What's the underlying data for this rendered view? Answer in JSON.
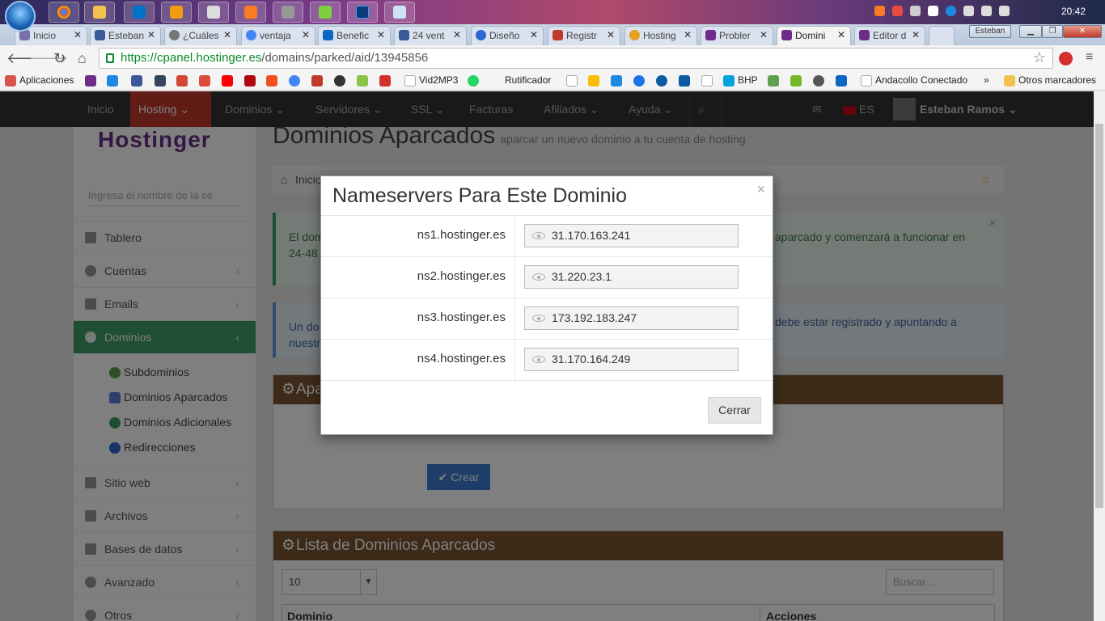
{
  "os": {
    "taskbar_apps": [
      "chrome-icon",
      "file-explorer-icon",
      "outlook-icon",
      "media-player-icon",
      "app-icon",
      "xampp-icon",
      "notepad-icon",
      "evernote-icon",
      "photoshop-icon",
      "files-icon"
    ],
    "clock": "20:42"
  },
  "browser": {
    "tabs": [
      {
        "label": "Inicio",
        "color": "#7a6fae"
      },
      {
        "label": "Esteban",
        "color": "#3b5998"
      },
      {
        "label": "¿Cuáles",
        "color": "#555555"
      },
      {
        "label": "ventaja",
        "color": "#4285f4"
      },
      {
        "label": "Benefic",
        "color": "#0a66c2"
      },
      {
        "label": "24 vent",
        "color": "#3a5a9a"
      },
      {
        "label": "Diseño",
        "color": "#2a6ad0"
      },
      {
        "label": "Registr",
        "color": "#c0392b"
      },
      {
        "label": "Hosting",
        "color": "#e5a020"
      },
      {
        "label": "Probler",
        "color": "#6d2c8a"
      },
      {
        "label": "Domini",
        "color": "#6d2c8a"
      },
      {
        "label": "Editor d",
        "color": "#6d2c8a"
      }
    ],
    "profile_name": "Esteban",
    "url_host": "https://cpanel.hostinger.es",
    "url_path": "/domains/parked/aid/13945856",
    "bookmarks": [
      {
        "label": "Aplicaciones",
        "color": "#d9534f"
      },
      {
        "label": "",
        "color": "#6d2c8a"
      },
      {
        "label": "",
        "color": "#1e88e5"
      },
      {
        "label": "",
        "color": "#3b5998"
      },
      {
        "label": "",
        "color": "#35465c"
      },
      {
        "label": "",
        "color": "#d14836"
      },
      {
        "label": "",
        "color": "#dd4b39"
      },
      {
        "label": "",
        "color": "#ff0000"
      },
      {
        "label": "",
        "color": "#b20710"
      },
      {
        "label": "",
        "color": "#f25022"
      },
      {
        "label": "",
        "color": "#4285f4"
      },
      {
        "label": "",
        "color": "#c0392b"
      },
      {
        "label": "",
        "color": "#333333"
      },
      {
        "label": "",
        "color": "#8bc34a"
      },
      {
        "label": "",
        "color": "#d32f2f"
      },
      {
        "label": "Vid2MP3",
        "color": "#888888"
      },
      {
        "label": "",
        "color": "#25d366"
      },
      {
        "label": "Rutificador",
        "color": "#888888"
      },
      {
        "label": "",
        "color": "#888888"
      },
      {
        "label": "",
        "color": "#fbbc05"
      },
      {
        "label": "",
        "color": "#1e88e5"
      },
      {
        "label": "",
        "color": "#1a73e8"
      },
      {
        "label": "",
        "color": "#0b5aa3"
      },
      {
        "label": "",
        "color": "#0b5aa3"
      },
      {
        "label": "",
        "color": "#888888"
      },
      {
        "label": "BHP",
        "color": "#00a3e0"
      },
      {
        "label": "",
        "color": "#5fa04e"
      },
      {
        "label": "",
        "color": "#76b82a"
      },
      {
        "label": "",
        "color": "#555555"
      },
      {
        "label": "",
        "color": "#0a66c2"
      },
      {
        "label": "Andacollo Conectado",
        "color": "#888888"
      }
    ],
    "bookmarks_more": "»",
    "other_bookmarks": "Otros marcadores"
  },
  "site": {
    "nav": [
      "Inicio",
      "Hosting",
      "Dominios",
      "Servidores",
      "SSL",
      "Facturas",
      "Afiliados",
      "Ayuda"
    ],
    "active_nav": "Hosting",
    "language": "ES",
    "user": "Esteban Ramos",
    "sidebar": {
      "logo": "Hostinger",
      "search_placeholder": "Ingresa el nombre de la se",
      "items": [
        "Tablero",
        "Cuentas",
        "Emails",
        "Dominios",
        "Sitio web",
        "Archivos",
        "Bases de datos",
        "Avanzado",
        "Otros"
      ],
      "subitems": [
        "Subdominios",
        "Dominios Aparcados",
        "Dominios Adicionales",
        "Redirecciones"
      ]
    },
    "page_title": "Dominios Aparcados",
    "page_subtitle": "aparcar un nuevo dominio a tu cuenta de hosting",
    "breadcrumb": "Inicio",
    "alert_success_left": "El dom",
    "alert_success_left2": "24-48",
    "alert_success_right": "aparcado y comenzará a funcionar en",
    "alert_info_left": "Un do",
    "alert_info_left2": "nuestr",
    "alert_info_right": "debe estar registrado y apuntando a",
    "panel_park_title": "Apa",
    "button_crear": "Crear",
    "panel_list_title": "Lista de Dominios Aparcados",
    "page_size": "10",
    "search_placeholder": "Buscar...",
    "table_headers": [
      "Dominio",
      "Acciones"
    ]
  },
  "modal": {
    "title": "Nameservers Para Este Dominio",
    "close_symbol": "×",
    "nameservers": [
      {
        "name": "ns1.hostinger.es",
        "ip": "31.170.163.241"
      },
      {
        "name": "ns2.hostinger.es",
        "ip": "31.220.23.1"
      },
      {
        "name": "ns3.hostinger.es",
        "ip": "173.192.183.247"
      },
      {
        "name": "ns4.hostinger.es",
        "ip": "31.170.164.249"
      }
    ],
    "button_close": "Cerrar"
  }
}
